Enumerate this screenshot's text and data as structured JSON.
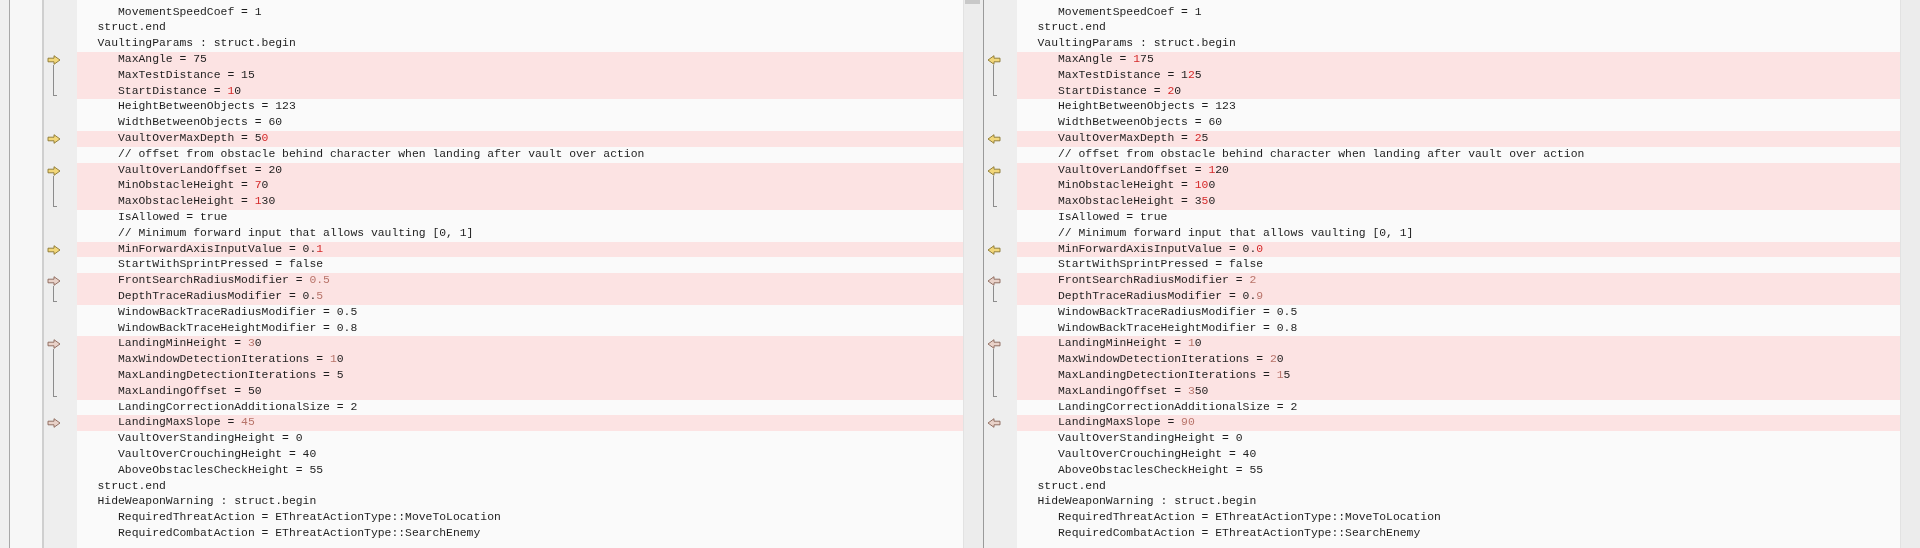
{
  "panes": [
    {
      "kind": "left",
      "scroll_thumb": true,
      "blocks": [
        {
          "changed": false,
          "lines": [
            [
              {
                "text": "      MovementSpeedCoef = 1"
              }
            ],
            [
              {
                "text": "   struct.end"
              }
            ],
            [
              {
                "text": "   VaultingParams : struct.begin"
              }
            ]
          ]
        },
        {
          "changed": true,
          "muted": false,
          "lines": [
            [
              {
                "text": "      MaxAngle = 75"
              }
            ],
            [
              {
                "text": "      MaxTestDistance = 15"
              }
            ],
            [
              {
                "text": "      StartDistance = "
              },
              {
                "text": "1",
                "diff": true
              },
              {
                "text": "0"
              }
            ]
          ]
        },
        {
          "changed": false,
          "lines": [
            [
              {
                "text": "      HeightBetweenObjects = 123"
              }
            ],
            [
              {
                "text": "      WidthBetweenObjects = 60"
              }
            ]
          ]
        },
        {
          "changed": true,
          "muted": false,
          "lines": [
            [
              {
                "text": "      VaultOverMaxDepth = 5"
              },
              {
                "text": "0",
                "diff": true
              }
            ]
          ]
        },
        {
          "changed": false,
          "lines": [
            [
              {
                "text": "      // offset from obstacle behind character when landing after vault over action"
              }
            ]
          ]
        },
        {
          "changed": true,
          "muted": false,
          "lines": [
            [
              {
                "text": "      VaultOverLandOffset = 20"
              }
            ],
            [
              {
                "text": "      MinObstacleHeight = "
              },
              {
                "text": "7",
                "diff": true
              },
              {
                "text": "0"
              }
            ],
            [
              {
                "text": "      MaxObstacleHeight = "
              },
              {
                "text": "1",
                "diff": true
              },
              {
                "text": "30"
              }
            ]
          ]
        },
        {
          "changed": false,
          "lines": [
            [
              {
                "text": "      IsAllowed = true"
              }
            ],
            [
              {
                "text": "      // Minimum forward input that allows vaulting [0, 1]"
              }
            ]
          ]
        },
        {
          "changed": true,
          "muted": false,
          "lines": [
            [
              {
                "text": "      MinForwardAxisInputValue = 0."
              },
              {
                "text": "1",
                "diff": true
              }
            ]
          ]
        },
        {
          "changed": false,
          "lines": [
            [
              {
                "text": "      StartWithSprintPressed = false"
              }
            ]
          ]
        },
        {
          "changed": true,
          "muted": true,
          "lines": [
            [
              {
                "text": "      FrontSearchRadiusModifier = "
              },
              {
                "text": "0.5",
                "diff": true
              }
            ],
            [
              {
                "text": "      DepthTraceRadiusModifier = 0."
              },
              {
                "text": "5",
                "diff": true
              }
            ]
          ]
        },
        {
          "changed": false,
          "lines": [
            [
              {
                "text": "      WindowBackTraceRadiusModifier = 0.5"
              }
            ],
            [
              {
                "text": "      WindowBackTraceHeightModifier = 0.8"
              }
            ]
          ]
        },
        {
          "changed": true,
          "muted": true,
          "lines": [
            [
              {
                "text": "      LandingMinHeight = "
              },
              {
                "text": "3",
                "diff": true
              },
              {
                "text": "0"
              }
            ],
            [
              {
                "text": "      MaxWindowDetectionIterations = "
              },
              {
                "text": "1",
                "diff": true
              },
              {
                "text": "0"
              }
            ],
            [
              {
                "text": "      MaxLandingDetectionIterations = 5"
              }
            ],
            [
              {
                "text": "      MaxLandingOffset = 50"
              }
            ]
          ]
        },
        {
          "changed": false,
          "lines": [
            [
              {
                "text": "      LandingCorrectionAdditionalSize = 2"
              }
            ]
          ]
        },
        {
          "changed": true,
          "muted": true,
          "lines": [
            [
              {
                "text": "      LandingMaxSlope = "
              },
              {
                "text": "45",
                "diff": true
              }
            ]
          ]
        },
        {
          "changed": false,
          "lines": [
            [
              {
                "text": "      VaultOverStandingHeight = 0"
              }
            ],
            [
              {
                "text": "      VaultOverCrouchingHeight = 40"
              }
            ],
            [
              {
                "text": "      AboveObstaclesCheckHeight = 55"
              }
            ],
            [
              {
                "text": "   struct.end"
              }
            ],
            [
              {
                "text": "   HideWeaponWarning : struct.begin"
              }
            ],
            [
              {
                "text": "      RequiredThreatAction = EThreatActionType::MoveToLocation"
              }
            ],
            [
              {
                "text": "      RequiredCombatAction = EThreatActionType::SearchEnemy"
              }
            ]
          ]
        }
      ]
    },
    {
      "kind": "right",
      "scroll_thumb": false,
      "blocks": [
        {
          "changed": false,
          "lines": [
            [
              {
                "text": "      MovementSpeedCoef = 1"
              }
            ],
            [
              {
                "text": "   struct.end"
              }
            ],
            [
              {
                "text": "   VaultingParams : struct.begin"
              }
            ]
          ]
        },
        {
          "changed": true,
          "muted": false,
          "lines": [
            [
              {
                "text": "      MaxAngle = "
              },
              {
                "text": "1",
                "diff": true
              },
              {
                "text": "75"
              }
            ],
            [
              {
                "text": "      MaxTestDistance = 1"
              },
              {
                "text": "2",
                "diff": true
              },
              {
                "text": "5"
              }
            ],
            [
              {
                "text": "      StartDistance = "
              },
              {
                "text": "2",
                "diff": true
              },
              {
                "text": "0"
              }
            ]
          ]
        },
        {
          "changed": false,
          "lines": [
            [
              {
                "text": "      HeightBetweenObjects = 123"
              }
            ],
            [
              {
                "text": "      WidthBetweenObjects = 60"
              }
            ]
          ]
        },
        {
          "changed": true,
          "muted": false,
          "lines": [
            [
              {
                "text": "      VaultOverMaxDepth = "
              },
              {
                "text": "2",
                "diff": true
              },
              {
                "text": "5"
              }
            ]
          ]
        },
        {
          "changed": false,
          "lines": [
            [
              {
                "text": "      // offset from obstacle behind character when landing after vault over action"
              }
            ]
          ]
        },
        {
          "changed": true,
          "muted": false,
          "lines": [
            [
              {
                "text": "      VaultOverLandOffset = "
              },
              {
                "text": "1",
                "diff": true
              },
              {
                "text": "20"
              }
            ],
            [
              {
                "text": "      MinObstacleHeight = "
              },
              {
                "text": "10",
                "diff": true
              },
              {
                "text": "0"
              }
            ],
            [
              {
                "text": "      MaxObstacleHeight = 3"
              },
              {
                "text": "5",
                "diff": true
              },
              {
                "text": "0"
              }
            ]
          ]
        },
        {
          "changed": false,
          "lines": [
            [
              {
                "text": "      IsAllowed = true"
              }
            ],
            [
              {
                "text": "      // Minimum forward input that allows vaulting [0, 1]"
              }
            ]
          ]
        },
        {
          "changed": true,
          "muted": false,
          "lines": [
            [
              {
                "text": "      MinForwardAxisInputValue = 0."
              },
              {
                "text": "0",
                "diff": true
              }
            ]
          ]
        },
        {
          "changed": false,
          "lines": [
            [
              {
                "text": "      StartWithSprintPressed = false"
              }
            ]
          ]
        },
        {
          "changed": true,
          "muted": true,
          "lines": [
            [
              {
                "text": "      FrontSearchRadiusModifier = "
              },
              {
                "text": "2",
                "diff": true
              }
            ],
            [
              {
                "text": "      DepthTraceRadiusModifier = 0."
              },
              {
                "text": "9",
                "diff": true
              }
            ]
          ]
        },
        {
          "changed": false,
          "lines": [
            [
              {
                "text": "      WindowBackTraceRadiusModifier = 0.5"
              }
            ],
            [
              {
                "text": "      WindowBackTraceHeightModifier = 0.8"
              }
            ]
          ]
        },
        {
          "changed": true,
          "muted": true,
          "lines": [
            [
              {
                "text": "      LandingMinHeight = "
              },
              {
                "text": "1",
                "diff": true
              },
              {
                "text": "0"
              }
            ],
            [
              {
                "text": "      MaxWindowDetectionIterations = "
              },
              {
                "text": "2",
                "diff": true
              },
              {
                "text": "0"
              }
            ],
            [
              {
                "text": "      MaxLandingDetectionIterations = "
              },
              {
                "text": "1",
                "diff": true
              },
              {
                "text": "5"
              }
            ],
            [
              {
                "text": "      MaxLandingOffset = "
              },
              {
                "text": "3",
                "diff": true
              },
              {
                "text": "50"
              }
            ]
          ]
        },
        {
          "changed": false,
          "lines": [
            [
              {
                "text": "      LandingCorrectionAdditionalSize = 2"
              }
            ]
          ]
        },
        {
          "changed": true,
          "muted": true,
          "lines": [
            [
              {
                "text": "      LandingMaxSlope = "
              },
              {
                "text": "90",
                "diff": true
              }
            ]
          ]
        },
        {
          "changed": false,
          "lines": [
            [
              {
                "text": "      VaultOverStandingHeight = 0"
              }
            ],
            [
              {
                "text": "      VaultOverCrouchingHeight = 40"
              }
            ],
            [
              {
                "text": "      AboveObstaclesCheckHeight = 55"
              }
            ],
            [
              {
                "text": "   struct.end"
              }
            ],
            [
              {
                "text": "   HideWeaponWarning : struct.begin"
              }
            ],
            [
              {
                "text": "      RequiredThreatAction = EThreatActionType::MoveToLocation"
              }
            ],
            [
              {
                "text": "      RequiredCombatAction = EThreatActionType::SearchEnemy"
              }
            ]
          ]
        }
      ]
    }
  ]
}
